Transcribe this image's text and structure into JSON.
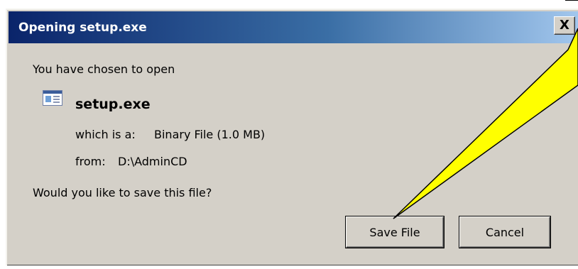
{
  "dialog": {
    "title": "Opening setup.exe",
    "close_glyph": "X",
    "intro": "You have chosen to open",
    "file_name": "setup.exe",
    "type_label": "which is a:",
    "type_value": "Binary File (1.0 MB)",
    "from_label": "from:",
    "from_value": "D:\\AdminCD",
    "question": "Would you like to save this file?",
    "save_label": "Save File",
    "cancel_label": "Cancel",
    "icon": "file-icon"
  },
  "colors": {
    "titlebar_start": "#0a246a",
    "titlebar_end": "#a6caf0",
    "dialog_bg": "#d4d0c8",
    "callout_fill": "#ffff00"
  }
}
